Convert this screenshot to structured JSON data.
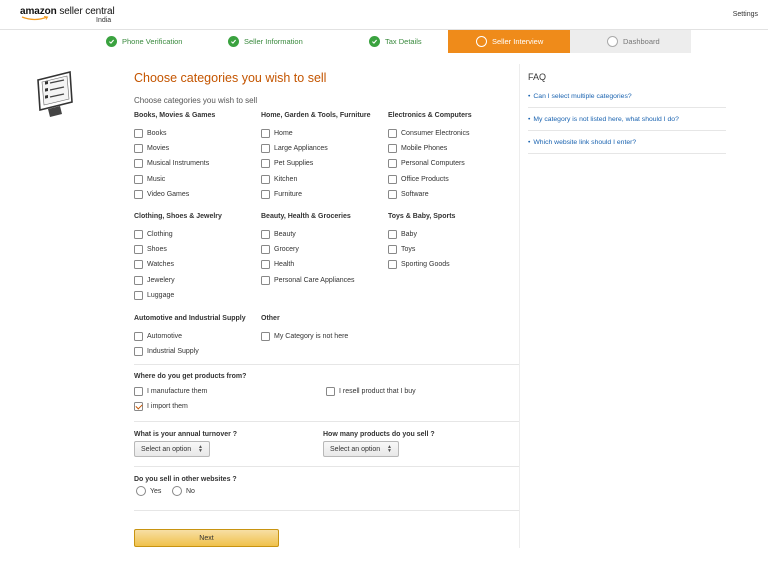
{
  "header": {
    "logo_text_bold": "amazon",
    "logo_text_rest": " seller central",
    "logo_region": "India",
    "settings_label": "Settings"
  },
  "stepper": {
    "steps": [
      {
        "label": "Phone Verification",
        "state": "done"
      },
      {
        "label": "Seller Information",
        "state": "done"
      },
      {
        "label": "Tax Details",
        "state": "done"
      },
      {
        "label": "Seller Interview",
        "state": "active"
      },
      {
        "label": "Dashboard",
        "state": "todo"
      }
    ]
  },
  "main": {
    "title": "Choose categories you wish to sell",
    "subtitle": "Choose categories you wish to sell",
    "category_groups": [
      {
        "title": "Books, Movies & Games",
        "items": [
          "Books",
          "Movies",
          "Musical Instruments",
          "Music",
          "Video Games"
        ]
      },
      {
        "title": "Home, Garden & Tools, Furniture",
        "items": [
          "Home",
          "Large Appliances",
          "Pet Supplies",
          "Kitchen",
          "Furniture"
        ]
      },
      {
        "title": "Electronics & Computers",
        "items": [
          "Consumer Electronics",
          "Mobile Phones",
          "Personal Computers",
          "Office Products",
          "Software"
        ]
      },
      {
        "title": "Clothing, Shoes & Jewelry",
        "items": [
          "Clothing",
          "Shoes",
          "Watches",
          "Jewelery",
          "Luggage"
        ]
      },
      {
        "title": "Beauty, Health & Groceries",
        "items": [
          "Beauty",
          "Grocery",
          "Health",
          "Personal Care Appliances"
        ]
      },
      {
        "title": "Toys & Baby, Sports",
        "items": [
          "Baby",
          "Toys",
          "Sporting Goods"
        ]
      },
      {
        "title": "Automotive and Industrial Supply",
        "items": [
          "Automotive",
          "Industrial Supply"
        ]
      },
      {
        "title": "Other",
        "items": [
          "My Category is not here"
        ]
      }
    ],
    "sourcing": {
      "question": "Where do you get products from?",
      "options": [
        {
          "label": "I manufacture them",
          "checked": false
        },
        {
          "label": "I resell product that I buy",
          "checked": false
        },
        {
          "label": "I import them",
          "checked": true
        }
      ]
    },
    "turnover": {
      "question": "What is your annual turnover ?",
      "selected": "Select an option"
    },
    "products_count": {
      "question": "How many products do you sell ?",
      "selected": "Select an option"
    },
    "other_websites": {
      "question": "Do you sell in other websites ?",
      "options": [
        "Yes",
        "No"
      ]
    },
    "next_label": "Next"
  },
  "faq": {
    "title": "FAQ",
    "items": [
      "Can I select multiple categories?",
      "My category is not listed here, what should I do?",
      "Which website link should I enter?"
    ]
  },
  "colors": {
    "accent_orange": "#ef8b1a",
    "title_orange": "#c45500",
    "done_green": "#3aa23f",
    "link_blue": "#1a63b0",
    "button_yellow": "#f0c14b"
  }
}
